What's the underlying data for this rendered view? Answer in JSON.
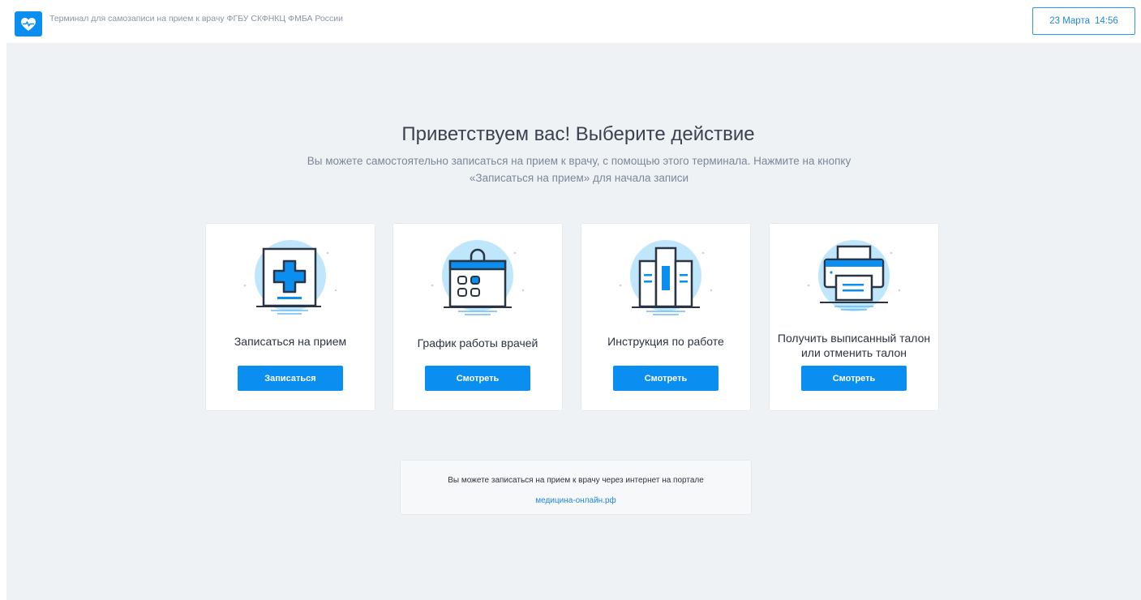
{
  "header": {
    "title": "Терминал для самозаписи на прием к врачу ФГБУ СКФНКЦ ФМБА России",
    "date": "23 Марта",
    "time": "14:56"
  },
  "welcome": {
    "title": "Приветствуем вас! Выберите действие",
    "subtitle": "Вы можете самостоятельно записаться на прием к врачу, с помощью этого терминала. Нажмите на кнопку «Записаться на прием» для начала записи"
  },
  "cards": [
    {
      "label": "Записаться на прием",
      "button": "Записаться",
      "icon": "medical-cross-icon"
    },
    {
      "label": "График работы врачей",
      "button": "Смотреть",
      "icon": "calendar-icon"
    },
    {
      "label": "Инструкция по работе",
      "button": "Смотреть",
      "icon": "books-icon"
    },
    {
      "label_line1": "Получить выписанный талон",
      "label_line2": "или отменить талон",
      "button": "Смотреть",
      "icon": "printer-icon"
    }
  ],
  "portal": {
    "text": "Вы можете записаться на прием к врачу через интернет на портале",
    "link": "медицина-онлайн.рф"
  },
  "colors": {
    "accent": "#0a8ef0",
    "illustration_circle": "#bfe6fb",
    "background": "#eff2f5"
  }
}
